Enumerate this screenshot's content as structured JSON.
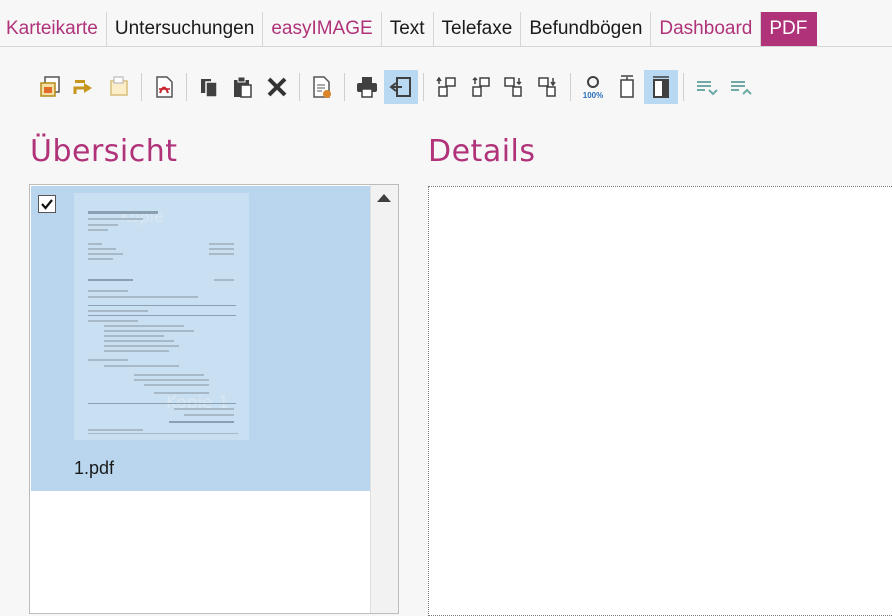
{
  "tabs": [
    {
      "label": "Karteikarte",
      "style": "accent"
    },
    {
      "label": "Untersuchungen",
      "style": "normal"
    },
    {
      "label": "easyIMAGE",
      "style": "accent"
    },
    {
      "label": "Text",
      "style": "normal"
    },
    {
      "label": "Telefaxe",
      "style": "normal"
    },
    {
      "label": "Befundbögen",
      "style": "normal"
    },
    {
      "label": "Dashboard",
      "style": "accent"
    },
    {
      "label": "PDF",
      "style": "active"
    }
  ],
  "colors": {
    "accent": "#b0337a",
    "selection": "#b9d6ee",
    "toolbar_active": "#b9d8f2"
  },
  "toolbar": {
    "icons": [
      "import-scan-icon",
      "export-icon",
      "folder-import-icon",
      "pdf-icon",
      "copy-icon",
      "paste-icon",
      "delete-icon",
      "document-edit-icon",
      "print-icon",
      "insert-left-icon",
      "move-first-icon",
      "move-up-icon",
      "move-down-icon",
      "move-last-icon",
      "zoom-100-icon",
      "fit-height-icon",
      "fit-width-icon",
      "list-previous-icon",
      "list-next-icon"
    ],
    "active_icon": "fit-width-icon",
    "zoom_text": "100%"
  },
  "overview": {
    "title": "Übersicht",
    "items": [
      {
        "filename": "1.pdf",
        "checked": true,
        "selected": true,
        "watermark": "Kopie 1"
      }
    ]
  },
  "details": {
    "title": "Details"
  }
}
